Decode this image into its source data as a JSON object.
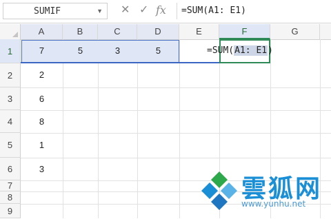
{
  "formula_bar": {
    "name_box": "SUMIF",
    "formula": "=SUM(A1: E1)",
    "icons": [
      "close-icon",
      "check-icon",
      "function-icon"
    ]
  },
  "columns": [
    "A",
    "B",
    "C",
    "D",
    "E",
    "F",
    "G"
  ],
  "rows": [
    "1",
    "2",
    "3",
    "4",
    "5",
    "6",
    "7",
    "8",
    "9"
  ],
  "cells": {
    "A1": "7",
    "B1": "5",
    "C1": "3",
    "D1": "5",
    "A2": "2",
    "A3": "6",
    "A4": "8",
    "A5": "1",
    "A6": "3"
  },
  "active_cell": {
    "formula_prefix": "=SUM(",
    "formula_ref": "A1: E1",
    "formula_suffix": ")"
  },
  "watermark": {
    "name": "雲狐网",
    "url": "www.yunhu.net"
  },
  "colors": {
    "selection": "#dfe6f6",
    "active_border": "#2e8b57",
    "range_border": "#3b66c3",
    "watermark": "#1a8fd6"
  }
}
